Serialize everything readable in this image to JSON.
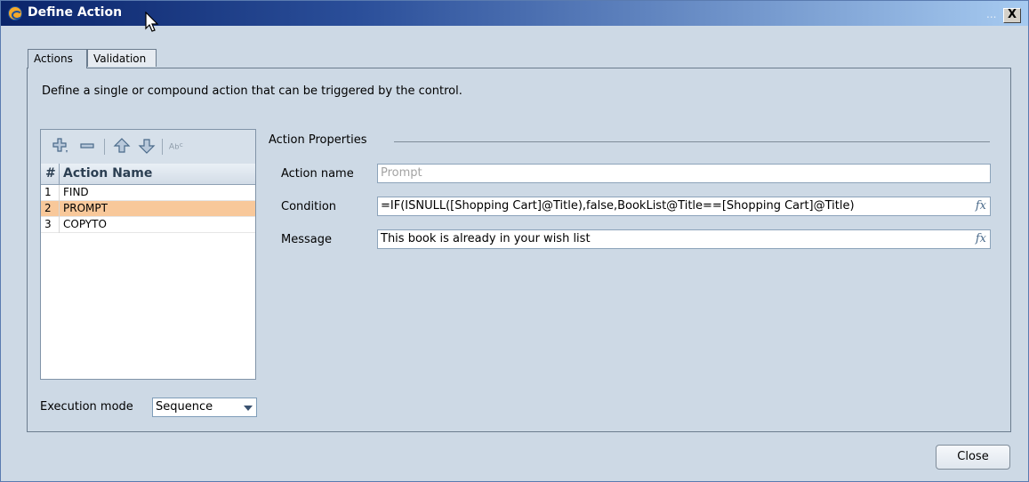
{
  "window": {
    "title": "Define Action",
    "title_suffix": "...",
    "close_label": "X"
  },
  "tabs": [
    {
      "label": "Actions",
      "active": true
    },
    {
      "label": "Validation",
      "active": false
    }
  ],
  "description": "Define a single or compound action that can be triggered by the control.",
  "toolbar": {
    "icons": [
      "add-icon",
      "remove-icon",
      "move-up-icon",
      "move-down-icon",
      "rename-icon"
    ]
  },
  "actions_list": {
    "headers": {
      "num": "#",
      "name": "Action Name"
    },
    "rows": [
      {
        "num": "1",
        "name": "FIND",
        "selected": false
      },
      {
        "num": "2",
        "name": "PROMPT",
        "selected": true
      },
      {
        "num": "3",
        "name": "COPYTO",
        "selected": false
      }
    ]
  },
  "execution_mode": {
    "label": "Execution mode",
    "value": "Sequence"
  },
  "action_properties": {
    "legend": "Action Properties",
    "action_name": {
      "label": "Action name",
      "placeholder": "Prompt"
    },
    "condition": {
      "label": "Condition",
      "value": "=IF(ISNULL([Shopping Cart]@Title),false,BookList@Title==[Shopping Cart]@Title)"
    },
    "message": {
      "label": "Message",
      "value": "This book is already in your wish list"
    }
  },
  "footer": {
    "close_label": "Close"
  },
  "colors": {
    "selected_row": "#f8c89a",
    "dialog_bg": "#cdd9e5",
    "titlebar_start": "#0a246a"
  }
}
